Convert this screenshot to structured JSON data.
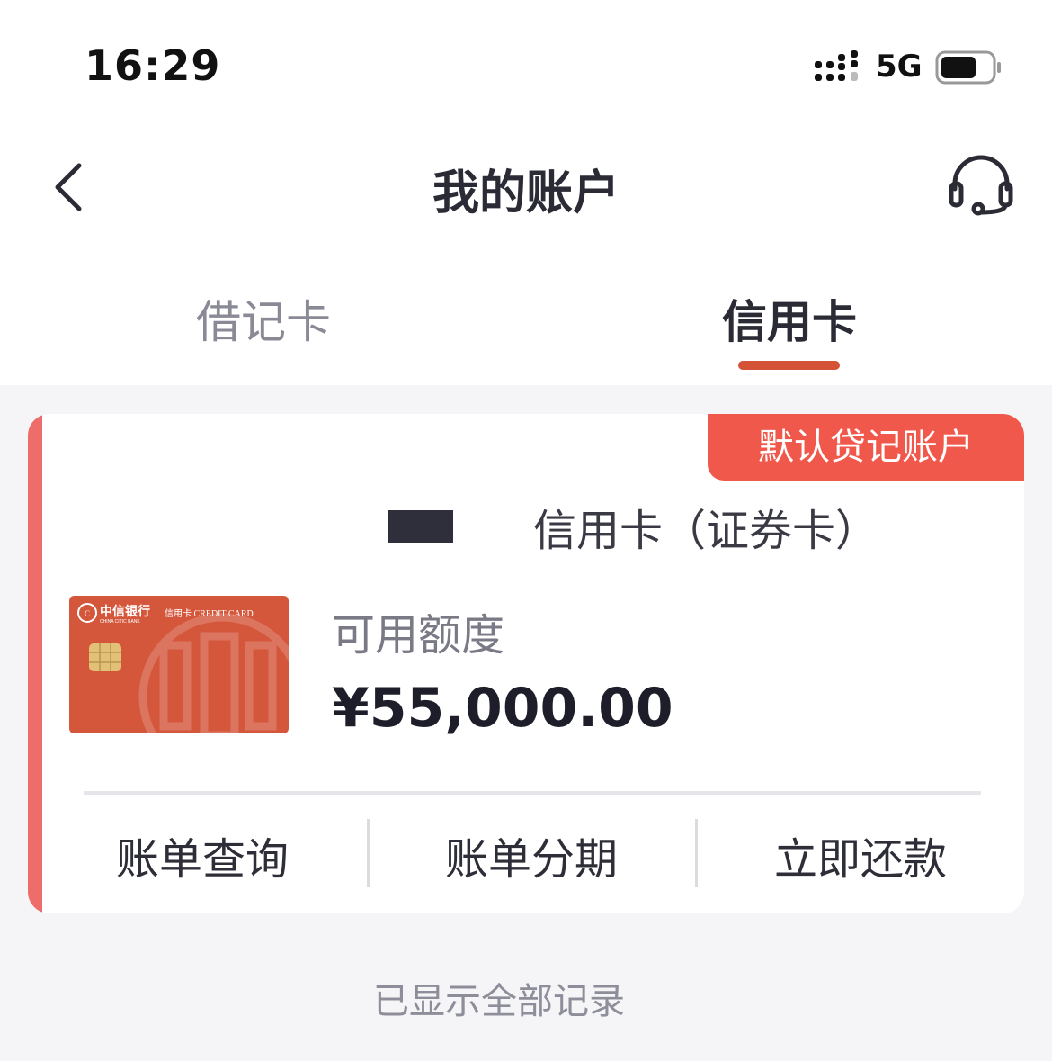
{
  "status_bar": {
    "time": "16:29",
    "network": "5G"
  },
  "header": {
    "title": "我的账户"
  },
  "tabs": [
    {
      "label": "借记卡",
      "active": false
    },
    {
      "label": "信用卡",
      "active": true
    }
  ],
  "card": {
    "badge": "默认贷记账户",
    "name": "信用卡（证券卡）",
    "image": {
      "bank_name": "中信银行",
      "bank_name_en": "CHINA CITIC BANK",
      "card_type": "信用卡 CREDIT CARD"
    },
    "limit_label": "可用额度",
    "limit_value": "¥55,000.00",
    "actions": [
      "账单查询",
      "账单分期",
      "立即还款"
    ]
  },
  "footer": {
    "note": "已显示全部记录"
  },
  "colors": {
    "accent": "#d45236",
    "badge": "#f0584b",
    "stripe": "#ee6d6b",
    "card": "#d4573c"
  }
}
